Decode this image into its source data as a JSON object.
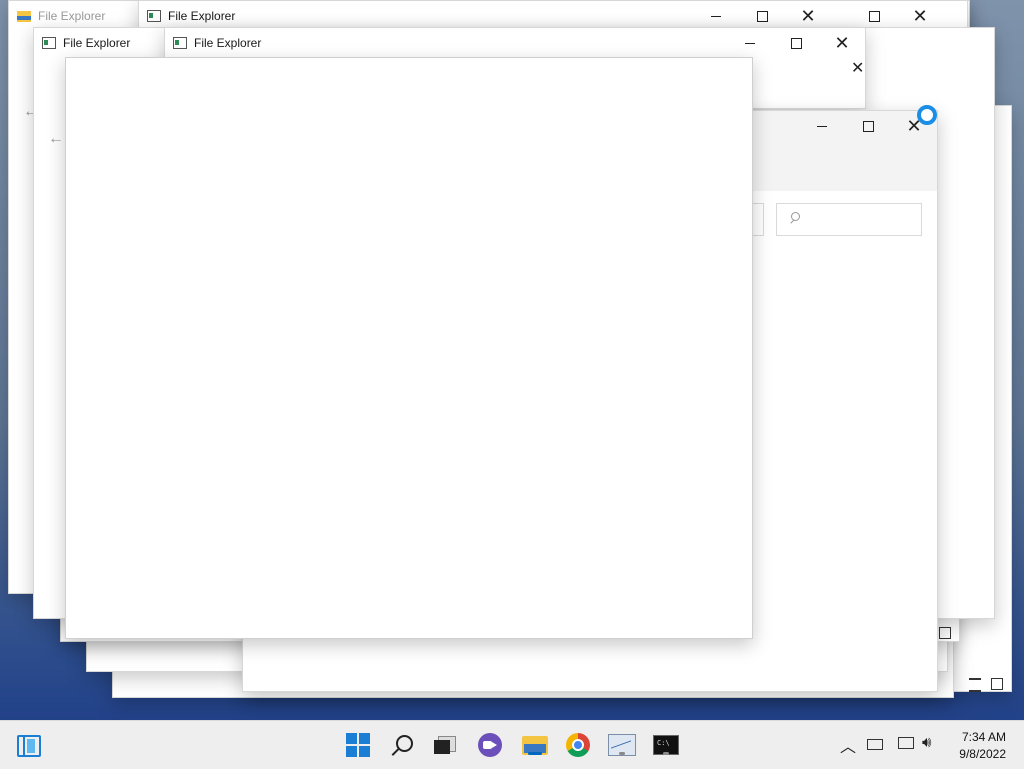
{
  "windows": {
    "back_left": {
      "title": "File Explorer"
    },
    "back_right": {
      "title": "File Explorer"
    },
    "middle_left": {
      "title": "File Explorer"
    },
    "front": {
      "title": "File Explorer"
    }
  },
  "taskbar": {
    "apps": [
      "widgets",
      "start",
      "search",
      "task-view",
      "chat",
      "file-explorer",
      "chrome",
      "performance-monitor",
      "command-prompt"
    ],
    "active_app": "file-explorer"
  },
  "clock": {
    "time": "7:34 AM",
    "date": "9/8/2022"
  },
  "colors": {
    "accent": "#0067c0",
    "loading_ring": "#1a8ee6"
  }
}
